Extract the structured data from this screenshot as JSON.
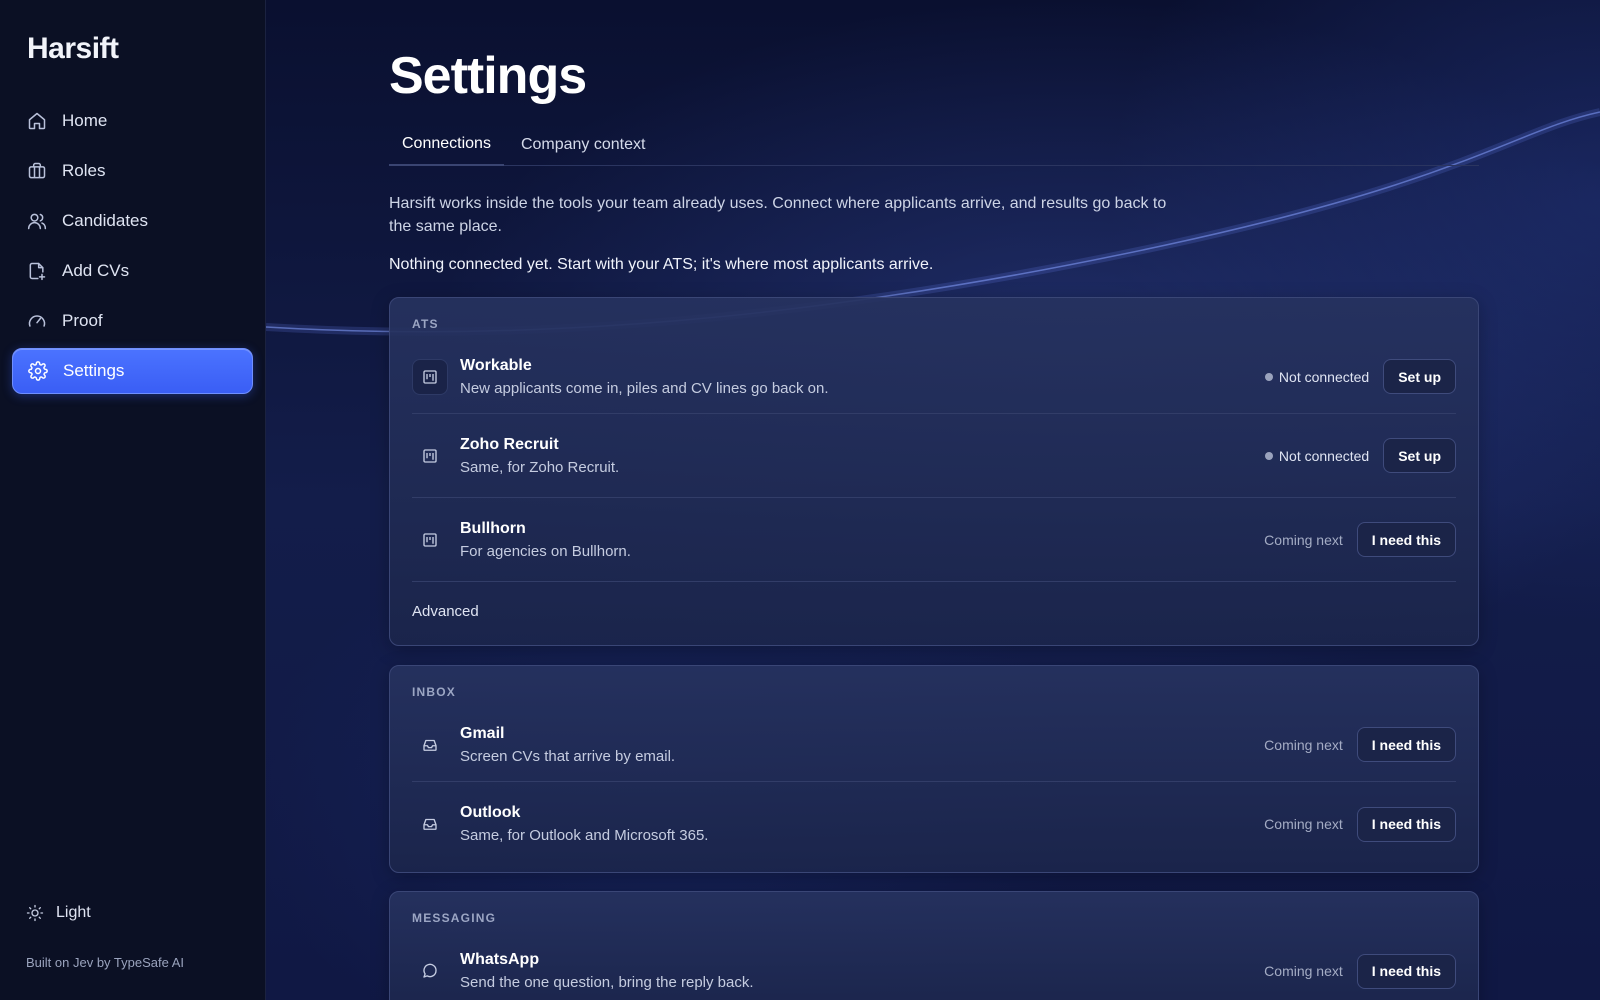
{
  "app": {
    "brand": "Harsift"
  },
  "sidebar": {
    "items": [
      {
        "label": "Home",
        "icon": "home-icon"
      },
      {
        "label": "Roles",
        "icon": "briefcase-icon"
      },
      {
        "label": "Candidates",
        "icon": "users-icon"
      },
      {
        "label": "Add CVs",
        "icon": "file-plus-icon"
      },
      {
        "label": "Proof",
        "icon": "gauge-icon"
      },
      {
        "label": "Settings",
        "icon": "gear-icon",
        "active": true
      }
    ],
    "theme_toggle": {
      "label": "Light",
      "icon": "sun-icon"
    },
    "built_on": "Built on Jev by TypeSafe AI"
  },
  "page": {
    "title": "Settings",
    "tabs": [
      {
        "label": "Connections",
        "active": true
      },
      {
        "label": "Company context",
        "active": false
      }
    ],
    "intro": "Harsift works inside the tools your team already uses. Connect where applicants arrive, and results go back to the same place.",
    "notice": "Nothing connected yet. Start with your ATS; it's where most applicants arrive."
  },
  "sections": {
    "ats": {
      "label": "ATS",
      "rows": [
        {
          "title": "Workable",
          "desc": "New applicants come in, piles and CV lines go back on.",
          "status": "Not connected",
          "action": "Set up",
          "icon": "kanban-icon"
        },
        {
          "title": "Zoho Recruit",
          "desc": "Same, for Zoho Recruit.",
          "status": "Not connected",
          "action": "Set up",
          "icon": "kanban-icon"
        },
        {
          "title": "Bullhorn",
          "desc": "For agencies on Bullhorn.",
          "status": "Coming next",
          "action": "I need this",
          "icon": "kanban-icon"
        }
      ],
      "advanced": "Advanced"
    },
    "inbox": {
      "label": "INBOX",
      "rows": [
        {
          "title": "Gmail",
          "desc": "Screen CVs that arrive by email.",
          "status": "Coming next",
          "action": "I need this",
          "icon": "inbox-icon"
        },
        {
          "title": "Outlook",
          "desc": "Same, for Outlook and Microsoft 365.",
          "status": "Coming next",
          "action": "I need this",
          "icon": "inbox-icon"
        }
      ]
    },
    "messaging": {
      "label": "MESSAGING",
      "rows": [
        {
          "title": "WhatsApp",
          "desc": "Send the one question, bring the reply back.",
          "status": "Coming next",
          "action": "I need this",
          "icon": "chat-bubble-icon"
        }
      ]
    }
  },
  "colors": {
    "accent": "#3f66f8",
    "background": "#0b1024",
    "card": "#22305e"
  }
}
